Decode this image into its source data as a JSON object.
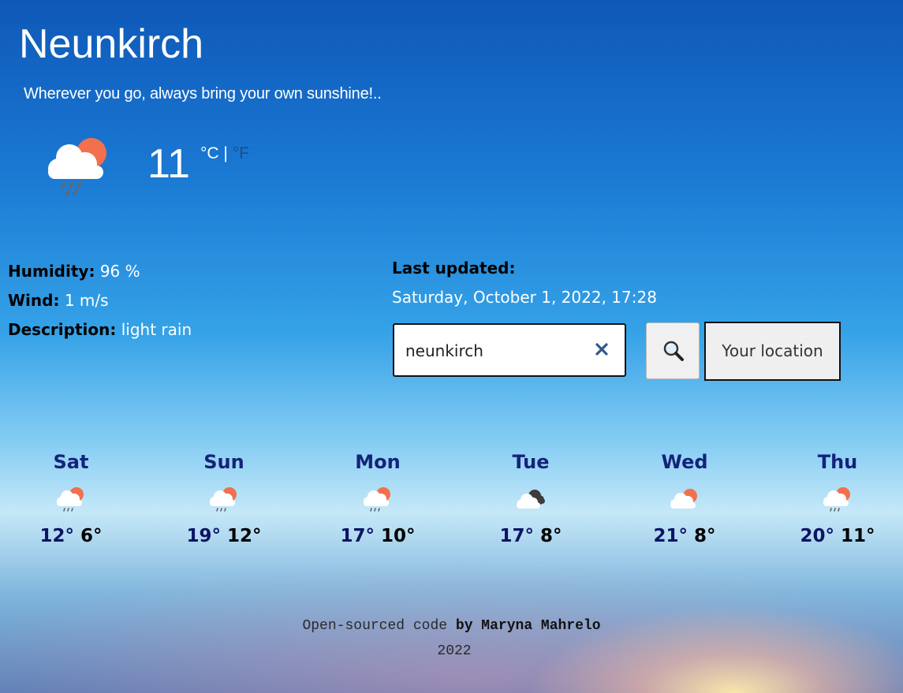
{
  "city": "Neunkirch",
  "tagline": "Wherever you go, always bring your own sunshine!..",
  "current": {
    "temperature": "11",
    "unit_c": "°C",
    "unit_sep": "|",
    "unit_f": "°F",
    "icon": "cloud-sun-rain-icon"
  },
  "details": {
    "humidity_label": "Humidity:",
    "humidity_value": "96 %",
    "wind_label": "Wind:",
    "wind_value": "1 m/s",
    "description_label": "Description:",
    "description_value": "light rain"
  },
  "updated": {
    "label": "Last updated:",
    "value": "Saturday, October 1, 2022, 17:28"
  },
  "search": {
    "value": "neunkirch",
    "placeholder": "",
    "location_button": "Your location"
  },
  "forecast": [
    {
      "day": "Sat",
      "hi": "12°",
      "lo": "6°",
      "icon": "cloud-sun-rain-icon"
    },
    {
      "day": "Sun",
      "hi": "19°",
      "lo": "12°",
      "icon": "cloud-sun-rain-icon"
    },
    {
      "day": "Mon",
      "hi": "17°",
      "lo": "10°",
      "icon": "cloud-sun-rain-icon"
    },
    {
      "day": "Tue",
      "hi": "17°",
      "lo": "8°",
      "icon": "clouds-icon"
    },
    {
      "day": "Wed",
      "hi": "21°",
      "lo": "8°",
      "icon": "cloud-sun-icon"
    },
    {
      "day": "Thu",
      "hi": "20°",
      "lo": "11°",
      "icon": "cloud-sun-rain-icon"
    }
  ],
  "footer": {
    "link_text": "Open-sourced code",
    "by_text": "by Maryna Mahrelo",
    "year": "2022"
  },
  "colors": {
    "sun": "#f2704e",
    "cloud": "#ffffff",
    "day_name": "#14237a",
    "hi_temp": "#0c1466"
  }
}
